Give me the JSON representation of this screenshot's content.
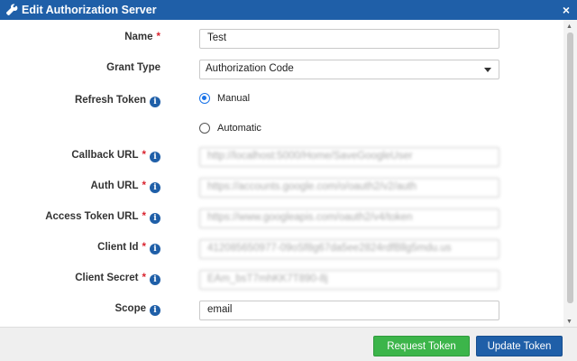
{
  "dialog": {
    "title": "Edit Authorization Server",
    "close_label": "×"
  },
  "fields": {
    "name": {
      "label": "Name",
      "value": "Test",
      "required": "*"
    },
    "grant_type": {
      "label": "Grant Type",
      "value": "Authorization Code"
    },
    "refresh_token": {
      "label": "Refresh Token",
      "options": [
        "Manual",
        "Automatic"
      ],
      "selected": "Manual"
    },
    "callback_url": {
      "label": "Callback URL",
      "value": "http://localhost:5000/Home/SaveGoogleUser",
      "required": "*"
    },
    "auth_url": {
      "label": "Auth URL",
      "value": "https://accounts.google.com/o/oauth2/v2/auth",
      "required": "*"
    },
    "access_token_url": {
      "label": "Access Token URL",
      "value": "https://www.googleapis.com/oauth2/v4/token",
      "required": "*"
    },
    "client_id": {
      "label": "Client Id",
      "value": "412085650977-09oSf8g67da5ee2824rdfBllg5mdu.us",
      "required": "*"
    },
    "client_secret": {
      "label": "Client Secret",
      "value": "EAm_bsT7mhKK7T890-8j",
      "required": "*"
    },
    "scope": {
      "label": "Scope",
      "value": "email"
    }
  },
  "info_icon_glyph": "i",
  "footer": {
    "request_token_label": "Request Token",
    "update_token_label": "Update Token"
  },
  "colors": {
    "accent": "#1f5fa8",
    "success": "#3cb54a",
    "required": "#d9232e"
  }
}
